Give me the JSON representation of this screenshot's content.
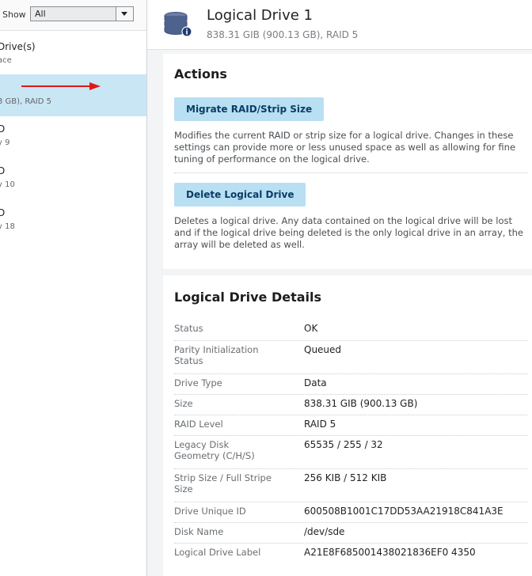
{
  "filter": {
    "show_label": "Show",
    "show_value": "All"
  },
  "tree": [
    {
      "title": "Drive(s)",
      "subtitle": "ace",
      "selected": false
    },
    {
      "title": "",
      "subtitle": "3 GB), RAID 5",
      "selected": true
    },
    {
      "title": "D",
      "subtitle": "y 9",
      "selected": false
    },
    {
      "title": "D",
      "subtitle": "y 10",
      "selected": false
    },
    {
      "title": "D",
      "subtitle": "y 18",
      "selected": false
    }
  ],
  "header": {
    "title": "Logical Drive 1",
    "subtitle": "838.31 GIB (900.13 GB), RAID 5",
    "icon": "database-icon"
  },
  "actions": {
    "title": "Actions",
    "migrate_label": "Migrate RAID/Strip Size",
    "migrate_desc": "Modifies the current RAID or strip size for a logical drive. Changes in these settings can provide more or less unused space as well as allowing for fine tuning of performance on the logical drive.",
    "delete_label": "Delete Logical Drive",
    "delete_desc": "Deletes a logical drive. Any data contained on the logical drive will be lost and if the logical drive being deleted is the only logical drive in an array, the array will be deleted as well."
  },
  "details": {
    "title": "Logical Drive Details",
    "rows": [
      {
        "label": "Status",
        "value": "OK"
      },
      {
        "label": "Parity Initialization Status",
        "value": "Queued"
      },
      {
        "label": "Drive Type",
        "value": "Data"
      },
      {
        "label": "Size",
        "value": "838.31 GIB (900.13 GB)"
      },
      {
        "label": "RAID Level",
        "value": "RAID 5"
      },
      {
        "label": "Legacy Disk Geometry (C/H/S)",
        "value": "65535 / 255 / 32"
      },
      {
        "label": "Strip Size / Full Stripe Size",
        "value": "256 KIB / 512 KIB"
      },
      {
        "label": "Drive Unique ID",
        "value": "600508B1001C17DD53AA21918C841A3E"
      },
      {
        "label": "Disk Name",
        "value": "/dev/sde"
      },
      {
        "label": "Logical Drive Label",
        "value": "A21E8F685001438021836EF0 4350"
      }
    ]
  },
  "colors": {
    "selected_bg": "#c9e6f5",
    "button_bg": "#b9dff3",
    "button_text": "#0a3d66",
    "annotation_arrow": "#e01818"
  }
}
